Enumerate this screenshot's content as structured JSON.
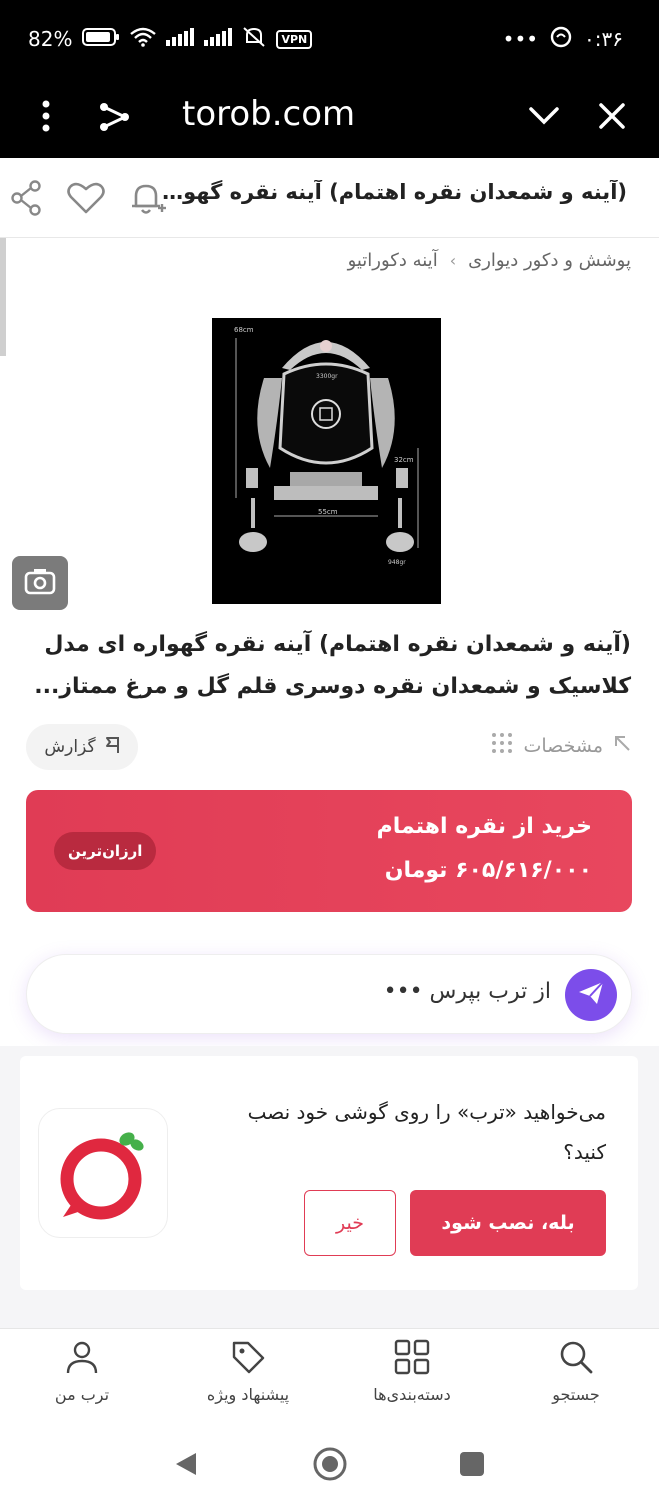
{
  "status_bar": {
    "time": "۰:۳۶",
    "battery": "82%",
    "vpn_label": "VPN",
    "more_dots": "•••"
  },
  "browser": {
    "url": "torob.com"
  },
  "header": {
    "title": "(آینه و شمعدان نقره اهتمام) آینه نقره گهوار..."
  },
  "breadcrumb": {
    "items": [
      "پوشش و دکور دیواری",
      "آینه دکوراتیو"
    ],
    "separator": "›"
  },
  "product": {
    "name": "(آینه و شمعدان نقره اهتمام) آینه نقره گهواره ای مدل کلاسیک و شمعدان نقره دوسری قلم گل و مرغ ممتاز...",
    "image_labels": {
      "height_mirror": "68cm",
      "weight_mirror": "3300gr",
      "height_candle": "32cm",
      "width": "55cm",
      "weight_candle": "948gr"
    }
  },
  "actions": {
    "specs_label": "مشخصات",
    "report_label": "گزارش"
  },
  "offer": {
    "shop_label": "خرید از نقره اهتمام",
    "price_label": "۶۰۵/۶۱۶/۰۰۰ تومان",
    "badge": "ارزان‌ترین"
  },
  "ask": {
    "placeholder": "از ترب بپرس •••"
  },
  "install_prompt": {
    "text": "می‌خواهید «ترب» را روی گوشی خود نصب کنید؟",
    "yes_label": "بله، نصب شود",
    "no_label": "خیر"
  },
  "bottom_nav": {
    "items": [
      {
        "label": "جستجو",
        "icon": "search-icon"
      },
      {
        "label": "دسته‌بندی‌ها",
        "icon": "grid-icon"
      },
      {
        "label": "پیشنهاد ویژه",
        "icon": "tag-icon"
      },
      {
        "label": "ترب من",
        "icon": "user-icon"
      }
    ]
  },
  "colors": {
    "brand": "#e03c55",
    "accent_purple": "#7c4dea"
  }
}
